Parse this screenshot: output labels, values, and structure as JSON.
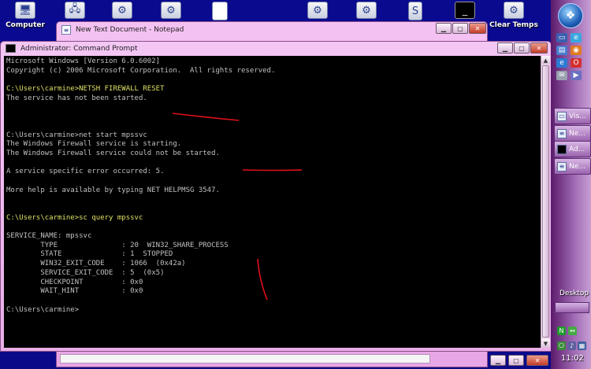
{
  "desktop": {
    "icons": [
      {
        "label": "Computer",
        "icon": "computer-icon"
      },
      {
        "label": "",
        "icon": "network-icon"
      },
      {
        "label": "",
        "icon": "gear-shortcut-icon"
      },
      {
        "label": "",
        "icon": "gear-shortcut-icon"
      },
      {
        "label": "",
        "icon": "document-icon"
      },
      {
        "label": "",
        "icon": "gear-shortcut-icon"
      },
      {
        "label": "",
        "icon": "gear-shortcut-icon"
      },
      {
        "label": "",
        "icon": "script-icon"
      },
      {
        "label": "",
        "icon": "cmd-shortcut-icon"
      },
      {
        "label": "Clear Temps",
        "icon": "gear-shortcut-icon"
      }
    ],
    "desktop_label": "Desktop"
  },
  "notepad": {
    "title": "New Text Document - Notepad"
  },
  "cmd": {
    "title": "Administrator: Command Prompt",
    "lines": [
      {
        "text": "Microsoft Windows [Version 6.0.6002]",
        "hl": false
      },
      {
        "text": "Copyright (c) 2006 Microsoft Corporation.  All rights reserved.",
        "hl": false
      },
      {
        "text": "",
        "hl": false
      },
      {
        "text": "C:\\Users\\carmine>NETSH FIREWALL RESET",
        "hl": true
      },
      {
        "text": "The service has not been started.",
        "hl": false
      },
      {
        "text": "",
        "hl": false
      },
      {
        "text": "",
        "hl": false
      },
      {
        "text": "",
        "hl": false
      },
      {
        "text": "C:\\Users\\carmine>net start mpssvc",
        "hl": false
      },
      {
        "text": "The Windows Firewall service is starting.",
        "hl": false
      },
      {
        "text": "The Windows Firewall service could not be started.",
        "hl": false
      },
      {
        "text": "",
        "hl": false
      },
      {
        "text": "A service specific error occurred: 5.",
        "hl": false
      },
      {
        "text": "",
        "hl": false
      },
      {
        "text": "More help is available by typing NET HELPMSG 3547.",
        "hl": false
      },
      {
        "text": "",
        "hl": false
      },
      {
        "text": "",
        "hl": false
      },
      {
        "text": "C:\\Users\\carmine>sc query mpssvc",
        "hl": true
      },
      {
        "text": "",
        "hl": false
      },
      {
        "text": "SERVICE_NAME: mpssvc",
        "hl": false
      },
      {
        "text": "        TYPE               : 20  WIN32_SHARE_PROCESS",
        "hl": false
      },
      {
        "text": "        STATE              : 1  STOPPED",
        "hl": false
      },
      {
        "text": "        WIN32_EXIT_CODE    : 1066  (0x42a)",
        "hl": false
      },
      {
        "text": "        SERVICE_EXIT_CODE  : 5  (0x5)",
        "hl": false
      },
      {
        "text": "        CHECKPOINT         : 0x0",
        "hl": false
      },
      {
        "text": "        WAIT_HINT          : 0x0",
        "hl": false
      },
      {
        "text": "",
        "hl": false
      },
      {
        "text": "C:\\Users\\carmine>",
        "hl": false
      }
    ]
  },
  "taskbar": {
    "buttons": [
      {
        "label": "Vis...",
        "icon": "window-icon"
      },
      {
        "label": "Ne...",
        "icon": "notepad-icon"
      },
      {
        "label": "Ad...",
        "icon": "cmd-icon"
      },
      {
        "label": "Ne...",
        "icon": "notepad-icon"
      }
    ],
    "clock": "11:02"
  },
  "colors": {
    "accent_pink": "#e8aee8",
    "annotation_red": "#e0101a",
    "highlight_text": "#e0e066"
  }
}
